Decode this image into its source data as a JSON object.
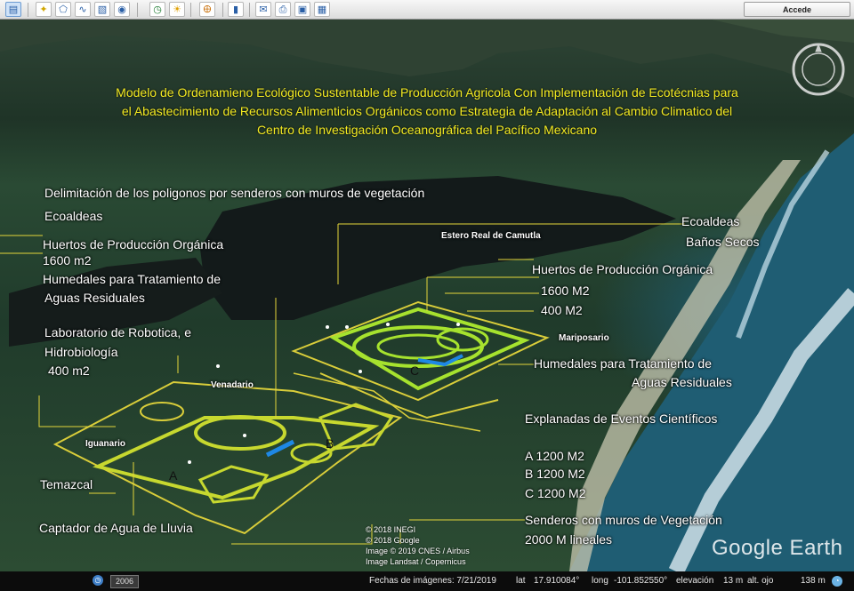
{
  "toolbar": {
    "accede_label": "Accede",
    "icons": [
      "sidebar-icon",
      "placemark-icon",
      "polygon-icon",
      "path-icon",
      "image-overlay-icon",
      "tour-icon",
      "history-icon",
      "sun-icon",
      "planets-icon",
      "ruler-icon",
      "email-icon",
      "print-icon",
      "save-image-icon",
      "maps-icon"
    ]
  },
  "title": {
    "line1": "Modelo de Ordenamieno Ecológico Sustentable de Producción Agricola Con Implementación de Ecotécnias para",
    "line2": "el Abastecimiento de Recursos Alimenticios Orgánicos  como Estrategia de  Adaptación al  Cambio Climatico del",
    "line3": "Centro de Investigación Oceanográfica del Pacífico Mexicano",
    "color": "#f3ea22"
  },
  "left_labels": {
    "delimitacion": "Delimitación de los poligonos por senderos con muros de vegetación",
    "ecoaldeas": "Ecoaldeas",
    "huertos": "Huertos de Producción Orgánica",
    "huertos_area": "1600 m2",
    "humedales": "Humedales para Tratamiento de",
    "humedales2": "Aguas Residuales",
    "laboratorio": "Laboratorio de Robotica, e",
    "hidrobiologia": "Hidrobiología",
    "lab_area": "400 m2",
    "temazcal": "Temazcal",
    "captador": "Captador de Agua de Lluvia"
  },
  "map_labels": {
    "estero": "Estero Real de Camutla",
    "venadario": "Venadario",
    "iguanario": "Iguanario",
    "mariposario": "Mariposario",
    "a": "A",
    "b": "B",
    "c": "C"
  },
  "right_labels": {
    "ecoaldeas": "Ecoaldeas",
    "banos": "Baños Secos",
    "huertos": "Huertos de Producción Orgánica",
    "area1600": "1600 M2",
    "area400": "400 M2",
    "humedales": "Humedales para Tratamiento de",
    "humedales2": "Aguas Residuales",
    "explanadas": "Explanadas  de Eventos Científicos",
    "a_row": "A  1200 M2",
    "b_row": "B   1200 M2",
    "c_row": "C   1200 M2",
    "senderos": "Senderos con muros de Vegetación",
    "senderos2": "2000 M lineales"
  },
  "credits": {
    "line1": "© 2018 INEGI",
    "line2": "© 2018 Google",
    "line3": "Image © 2019 CNES / Airbus",
    "line4": "Image Landsat / Copernicus",
    "brand": "Google Earth"
  },
  "status": {
    "year": "2006",
    "fecha": "Fechas de imágenes: 7/21/2019",
    "lat_label": "lat",
    "lat": "17.910084°",
    "long_label": "long",
    "long": "-101.852550°",
    "elev_label": "elevación",
    "elev": "13 m",
    "alt_label": "alt. ojo",
    "alt": "138 m"
  },
  "overlay_colors": {
    "polygon_lines": "#d9cd3a",
    "green_fill": "#a6e22e",
    "water_feature": "#1e88e5"
  }
}
